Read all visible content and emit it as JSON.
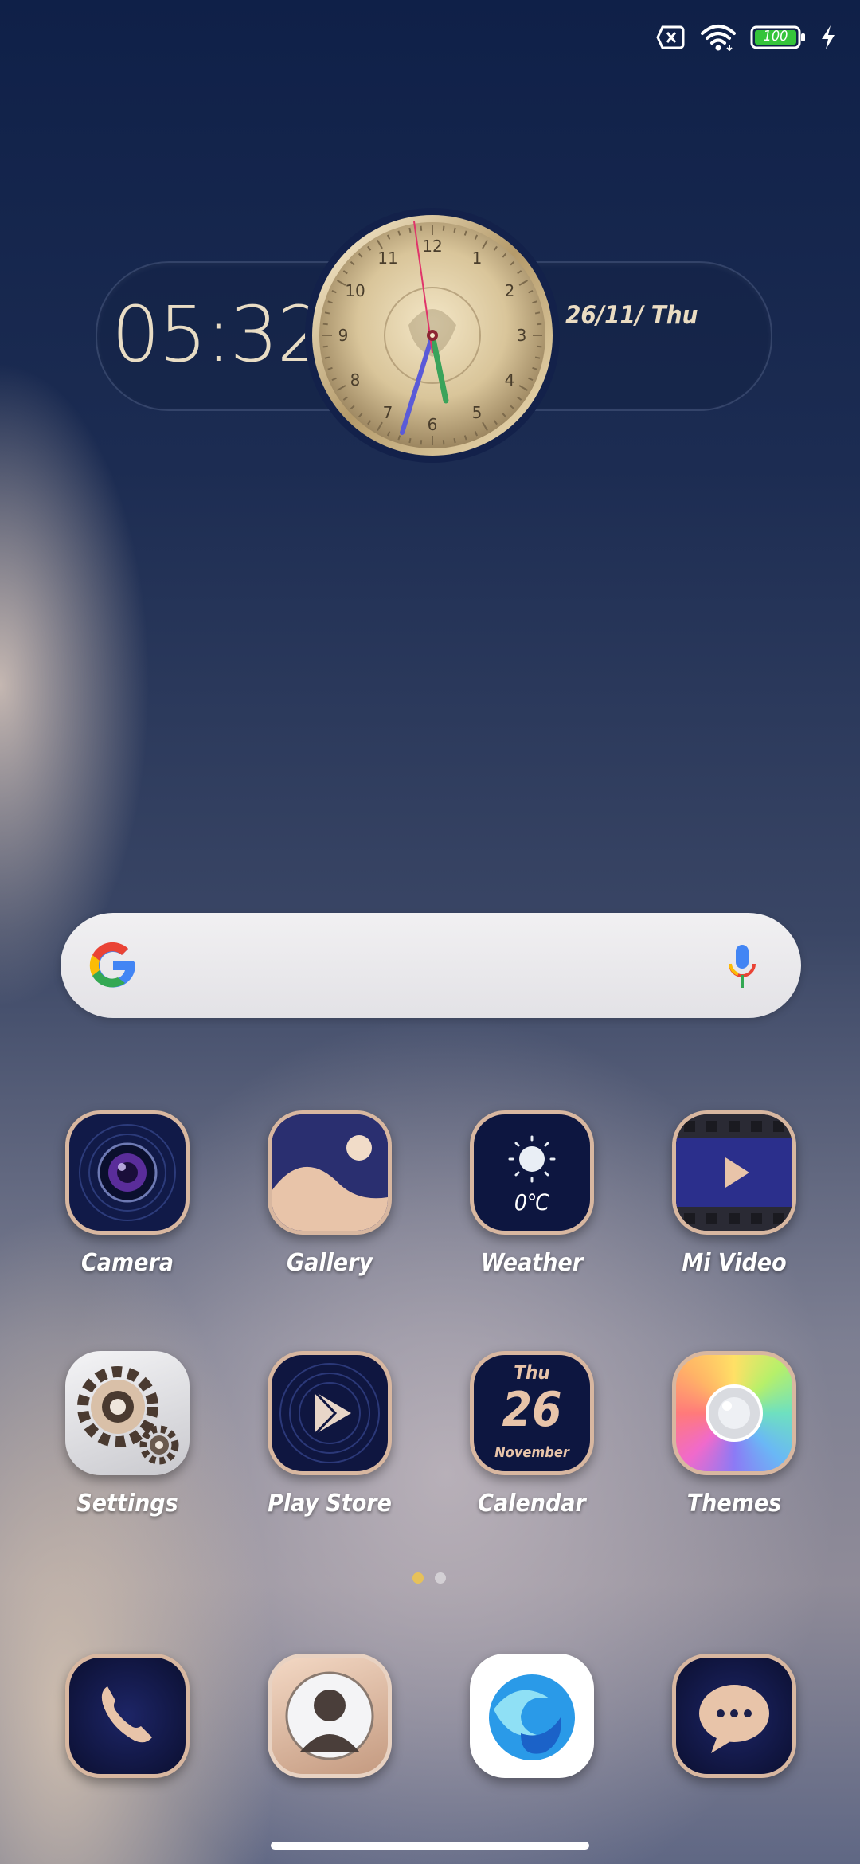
{
  "status_bar": {
    "battery_level": "100",
    "icons": [
      "no-sim-icon",
      "wifi-icon",
      "battery-icon",
      "charging-icon"
    ]
  },
  "clock_widget": {
    "time": "05:32",
    "date": "26/11/ Thu",
    "dial_numbers": [
      "12",
      "1",
      "2",
      "3",
      "4",
      "5",
      "6",
      "7",
      "8",
      "9",
      "10",
      "11"
    ]
  },
  "search": {
    "logo_letter": "G",
    "icons": [
      "google-logo-icon",
      "microphone-icon"
    ]
  },
  "apps": [
    {
      "label": "Camera"
    },
    {
      "label": "Gallery"
    },
    {
      "label": "Weather",
      "icon_text": "0℃"
    },
    {
      "label": "Mi Video"
    },
    {
      "label": "Settings"
    },
    {
      "label": "Play Store"
    },
    {
      "label": "Calendar",
      "icon_day": "Thu",
      "icon_date": "26",
      "icon_month": "November"
    },
    {
      "label": "Themes"
    }
  ],
  "page_indicator": {
    "pages": 2,
    "current": 1
  },
  "dock": [
    {
      "name": "phone-icon"
    },
    {
      "name": "contacts-icon"
    },
    {
      "name": "browser-icon"
    },
    {
      "name": "messages-icon"
    }
  ],
  "colors": {
    "accent_gold": "#e6c15a",
    "label_white": "#ffffff",
    "clock_text": "#e8dcc4",
    "icon_navy": "#0f1a45",
    "icon_rim": "#d9b79a"
  }
}
